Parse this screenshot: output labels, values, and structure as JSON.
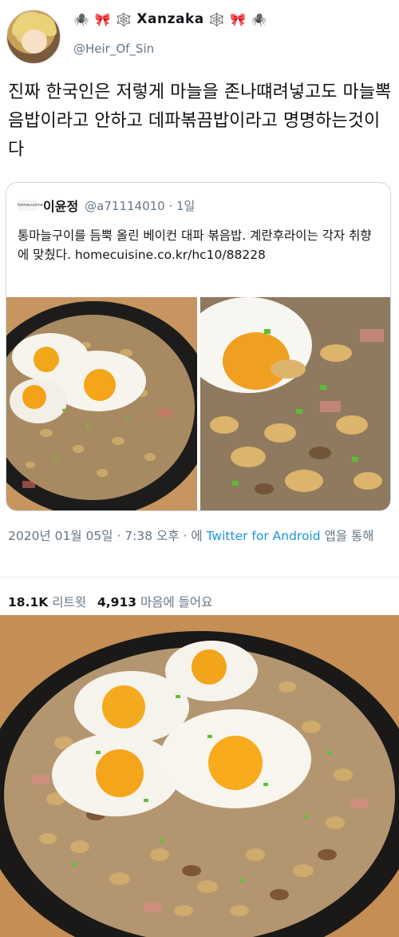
{
  "header": {
    "display_name": "Xanzaka",
    "handle": "@Heir_Of_Sin",
    "deco_left": "🕷️ 🎀 🕸️",
    "deco_right": "🕸️ 🎀 🕷️"
  },
  "tweet": {
    "text": "진짜 한국인은 저렇게 마늘을 존나떄려넣고도 마늘뽁음밥이라고 안하고 데파볶끔밥이라고 명명하는것이다"
  },
  "quoted": {
    "logo_text": "homecuisine",
    "name": "이윤정",
    "handle_time": "@a71114010 · 1일",
    "text": "통마늘구이를 듬뿍 올린 베이컨 대파 볶음밥. 계란후라이는 각자 취향에 맞췄다. homecuisine.co.kr/hc10/88228"
  },
  "meta": {
    "timestamp": "2020년 01월 05일 · 7:38 오후 · 에 ",
    "source": "Twitter for Android",
    "suffix": " 앱을 통해"
  },
  "stats": {
    "retweets_count": "18.1K",
    "retweets_label": "리트윗",
    "likes_count": "4,913",
    "likes_label": "마음에 들어요"
  },
  "colors": {
    "link": "#1b95e0",
    "muted": "#657786",
    "border": "#cfd9de"
  }
}
